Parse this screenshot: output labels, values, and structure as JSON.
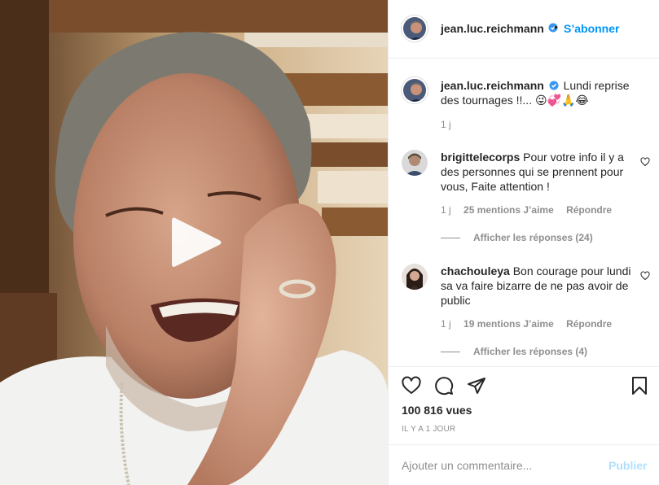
{
  "post": {
    "username": "jean.luc.reichmann",
    "separator": "•",
    "follow_label": "S’abonner",
    "caption_text": "Lundi reprise des tournages !!... 😜💞🙏😂",
    "caption_time": "1 j",
    "views": "100 816 vues",
    "posted_ago": "IL Y A 1 JOUR"
  },
  "comments": [
    {
      "username": "brigittelecorps",
      "text": "Pour votre info il y a des personnes qui se prennent pour vous, Faite attention !",
      "time": "1 j",
      "likes": "25 mentions J’aime",
      "reply_label": "Répondre",
      "view_replies": "Afficher les réponses (24)"
    },
    {
      "username": "chachouleya",
      "text": "Bon courage pour lundi sa va faire bizarre de ne pas avoir de public",
      "time": "1 j",
      "likes": "19 mentions J’aime",
      "reply_label": "Répondre",
      "view_replies": "Afficher les réponses (4)"
    }
  ],
  "comment_box": {
    "placeholder": "Ajouter un commentaire...",
    "publish_label": "Publier"
  },
  "icons": {
    "like": "heart-icon",
    "comment": "comment-icon",
    "share": "paper-plane-icon",
    "save": "bookmark-icon",
    "play": "play-icon",
    "verified": "verified-badge-icon"
  },
  "colors": {
    "link_blue": "#0095f6",
    "publish_disabled": "#b2dffc",
    "secondary_text": "#8e8e8e",
    "primary_text": "#262626"
  }
}
